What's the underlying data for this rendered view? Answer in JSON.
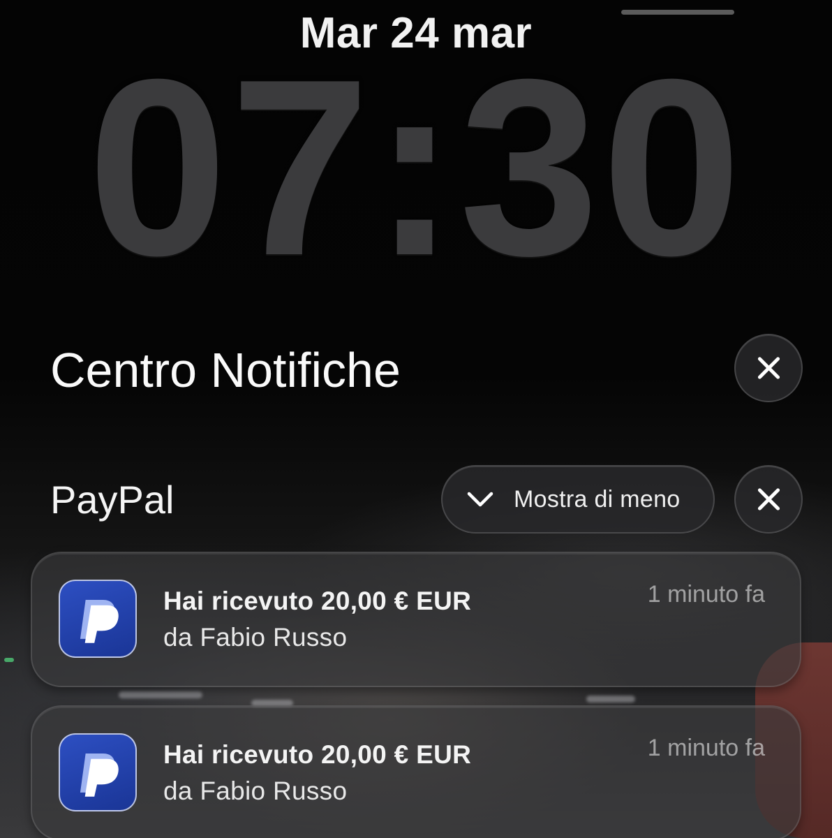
{
  "lock_screen": {
    "date": "Mar 24 mar",
    "time": "07:30"
  },
  "notification_center": {
    "title": "Centro Notifiche",
    "close_icon": "close-icon"
  },
  "group": {
    "app_name": "PayPal",
    "collapse_label": "Mostra di meno",
    "collapse_icon": "chevron-down-icon",
    "close_icon": "close-icon",
    "app_icon": "paypal-icon",
    "notifications": [
      {
        "title": "Hai ricevuto 20,00 € EUR",
        "body": "da Fabio Russo",
        "time": "1 minuto fa"
      },
      {
        "title": "Hai ricevuto 20,00 € EUR",
        "body": "da Fabio Russo",
        "time": "1 minuto fa"
      }
    ]
  },
  "colors": {
    "paypal_blue": "#1f3fa8",
    "clock_gray": "#3b3b3d"
  }
}
